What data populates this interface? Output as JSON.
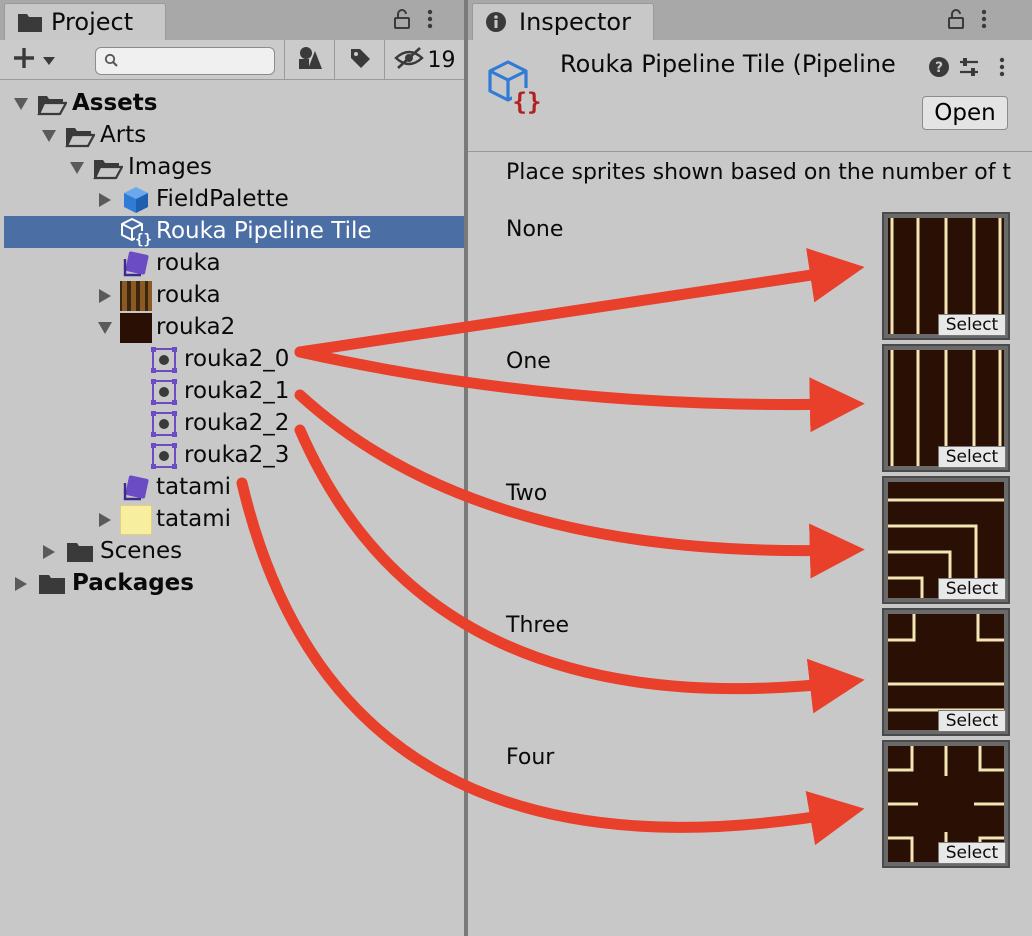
{
  "project": {
    "tab_label": "Project",
    "hidden_count": "19",
    "search": {
      "value": "",
      "placeholder": ""
    },
    "tree": [
      {
        "label": "Assets",
        "bold": true,
        "depth": 0,
        "arrow": "down",
        "icon": "open-folder-icon"
      },
      {
        "label": "Arts",
        "depth": 1,
        "arrow": "down",
        "icon": "open-folder-icon"
      },
      {
        "label": "Images",
        "depth": 2,
        "arrow": "down",
        "icon": "open-folder-icon"
      },
      {
        "label": "FieldPalette",
        "depth": 3,
        "arrow": "right",
        "icon": "prefab-cube-icon"
      },
      {
        "label": "Rouka Pipeline Tile",
        "depth": 3,
        "arrow": "none",
        "icon": "scriptable-tile-icon",
        "selected": true
      },
      {
        "label": "rouka",
        "depth": 3,
        "arrow": "none",
        "icon": "tile-asset-icon"
      },
      {
        "label": "rouka",
        "depth": 3,
        "arrow": "right",
        "icon": "rouka-texture-thumb-icon"
      },
      {
        "label": "rouka2",
        "depth": 3,
        "arrow": "down",
        "icon": "rouka2-texture-thumb-icon"
      },
      {
        "label": "rouka2_0",
        "depth": 4,
        "arrow": "none",
        "icon": "sprite-icon"
      },
      {
        "label": "rouka2_1",
        "depth": 4,
        "arrow": "none",
        "icon": "sprite-icon"
      },
      {
        "label": "rouka2_2",
        "depth": 4,
        "arrow": "none",
        "icon": "sprite-icon"
      },
      {
        "label": "rouka2_3",
        "depth": 4,
        "arrow": "none",
        "icon": "sprite-icon"
      },
      {
        "label": "tatami",
        "depth": 3,
        "arrow": "none",
        "icon": "tile-asset-icon"
      },
      {
        "label": "tatami",
        "depth": 3,
        "arrow": "right",
        "icon": "tatami-texture-thumb-icon"
      },
      {
        "label": "Scenes",
        "depth": 1,
        "arrow": "right",
        "icon": "folder-icon"
      },
      {
        "label": "Packages",
        "bold": true,
        "depth": 0,
        "arrow": "right",
        "icon": "folder-icon"
      }
    ]
  },
  "inspector": {
    "tab_label": "Inspector",
    "title": "Rouka Pipeline Tile (Pipeline",
    "open_label": "Open",
    "description": "Place sprites shown based on the number of t",
    "rules": [
      {
        "label": "None",
        "select_label": "Select",
        "pattern": "none"
      },
      {
        "label": "One",
        "select_label": "Select",
        "pattern": "one"
      },
      {
        "label": "Two",
        "select_label": "Select",
        "pattern": "two"
      },
      {
        "label": "Three",
        "select_label": "Select",
        "pattern": "three"
      },
      {
        "label": "Four",
        "select_label": "Select",
        "pattern": "four"
      }
    ]
  },
  "colors": {
    "selection": "#4b6ea5",
    "arrow": "#e8402a",
    "tile_bg": "#2a0f04",
    "tile_line": "#f3e6b4",
    "sprite_icon": "#6b4cc4",
    "prefab_icon": "#2f7bd6"
  }
}
